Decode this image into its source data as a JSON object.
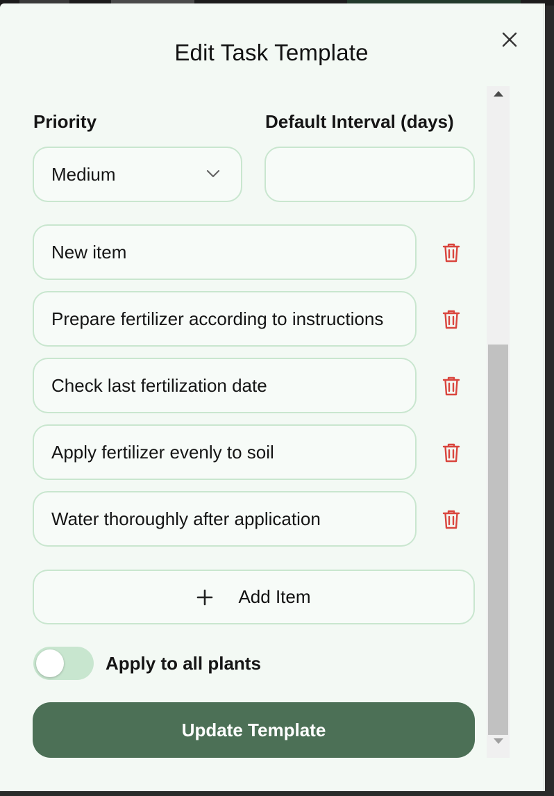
{
  "modal": {
    "title": "Edit Task Template"
  },
  "form": {
    "priority_label": "Priority",
    "priority_value": "Medium",
    "interval_label": "Default Interval (days)",
    "interval_value": ""
  },
  "checklist": [
    {
      "text": "New item"
    },
    {
      "text": "Prepare fertilizer according to instructions"
    },
    {
      "text": "Check last fertilization date"
    },
    {
      "text": "Apply fertilizer evenly to soil"
    },
    {
      "text": "Water thoroughly after application"
    }
  ],
  "add_item_label": "Add Item",
  "apply_all": {
    "label": "Apply to all plants",
    "enabled": false
  },
  "submit_label": "Update Template",
  "icons": {
    "close": "close-icon",
    "dropdown": "chevron-down-icon",
    "delete": "trash-icon",
    "add": "plus-icon"
  },
  "colors": {
    "background": "#f3f9f4",
    "field_border": "#c9e6cf",
    "delete_red": "#d9453d",
    "primary_button": "#4c7056",
    "toggle_track": "#c8e6cf"
  }
}
